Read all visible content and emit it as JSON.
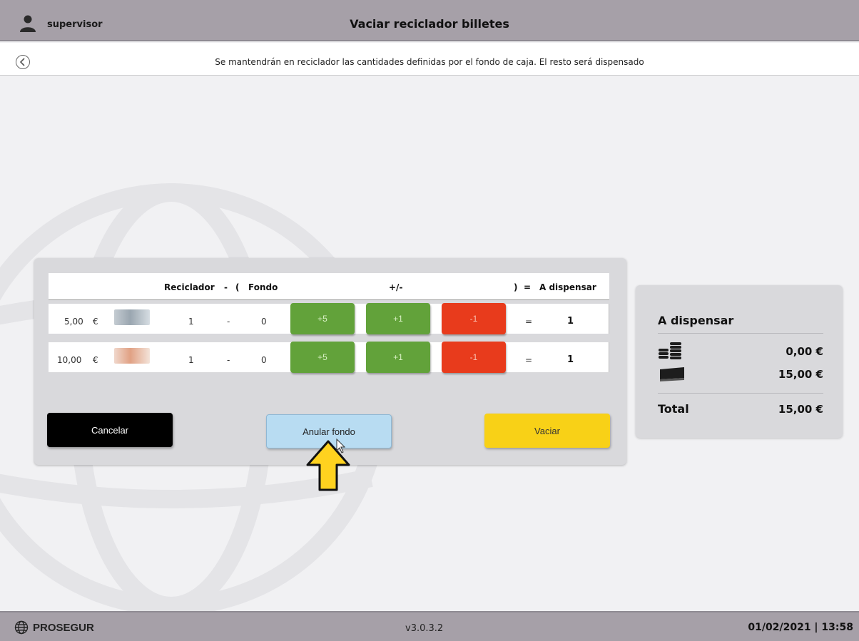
{
  "header": {
    "username": "supervisor",
    "title": "Vaciar reciclador billetes",
    "subtitle": "Se mantendrán en reciclador las cantidades definidas por el fondo de caja. El resto será dispensado",
    "user_icon": "user-icon",
    "back_icon": "back-arrow-icon"
  },
  "table": {
    "headers": {
      "reciclador": "Reciclador",
      "minus": "-",
      "open_paren": "(",
      "fondo": "Fondo",
      "plus_minus": "+/-",
      "close_paren": ")",
      "equals": "=",
      "a_dispensar": "A dispensar"
    },
    "rows": [
      {
        "denomination": "5,00",
        "currency": "€",
        "reciclador": "1",
        "minus": "-",
        "fondo": "0",
        "btn_plus5": "+5",
        "btn_plus1": "+1",
        "btn_minus1": "-1",
        "equals": "=",
        "a_dispensar": "1"
      },
      {
        "denomination": "10,00",
        "currency": "€",
        "reciclador": "1",
        "minus": "-",
        "fondo": "0",
        "btn_plus5": "+5",
        "btn_plus1": "+1",
        "btn_minus1": "-1",
        "equals": "=",
        "a_dispensar": "1"
      }
    ]
  },
  "actions": {
    "cancel": "Cancelar",
    "anular": "Anular fondo",
    "vaciar": "Vaciar"
  },
  "summary": {
    "title": "A dispensar",
    "coins_amount": "0,00 €",
    "bills_amount": "15,00 €",
    "total_label": "Total",
    "total_amount": "15,00 €"
  },
  "footer": {
    "brand": "PROSEGUR",
    "version": "v3.0.3.2",
    "datetime": "01/02/2021 | 13:58"
  },
  "colors": {
    "header_bg": "#a6a0a8",
    "green": "#62a23a",
    "red": "#e83b1c",
    "blue": "#b8dcf2",
    "yellow": "#f8d117",
    "arrow": "#ffd21f"
  }
}
